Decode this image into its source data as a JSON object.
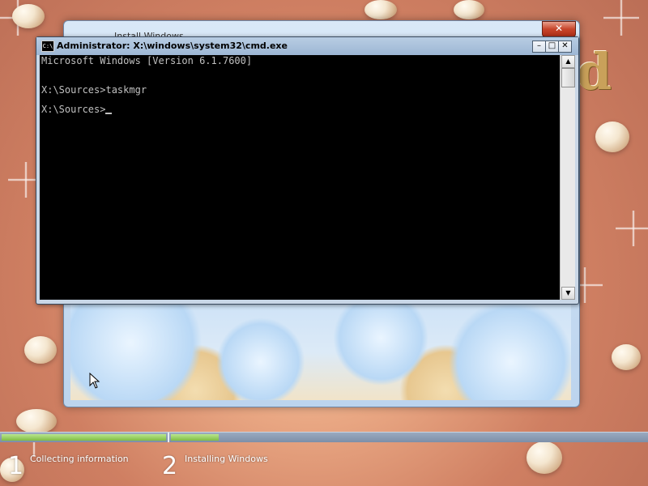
{
  "install_window": {
    "title": "Install Windows",
    "close_glyph": "✕"
  },
  "cmd": {
    "title": "Administrator: X:\\windows\\system32\\cmd.exe",
    "icon_glyph": "C:\\",
    "minimize_glyph": "–",
    "maximize_glyph": "□",
    "close_glyph": "✕",
    "lines": [
      "Microsoft Windows [Version 6.1.7600]",
      "",
      "X:\\Sources>taskmgr",
      "",
      "X:\\Sources>"
    ],
    "scroll_up_glyph": "▲",
    "scroll_down_glyph": "▼"
  },
  "setup_progress": {
    "step1_progress": 1.0,
    "step2_progress": 0.1,
    "steps": [
      {
        "number": "1",
        "label": "Collecting information"
      },
      {
        "number": "2",
        "label": "Installing Windows"
      }
    ]
  },
  "colors": {
    "console_bg": "#000000",
    "console_text": "#c0c0c0",
    "progress_fill": "#7fbe44"
  }
}
